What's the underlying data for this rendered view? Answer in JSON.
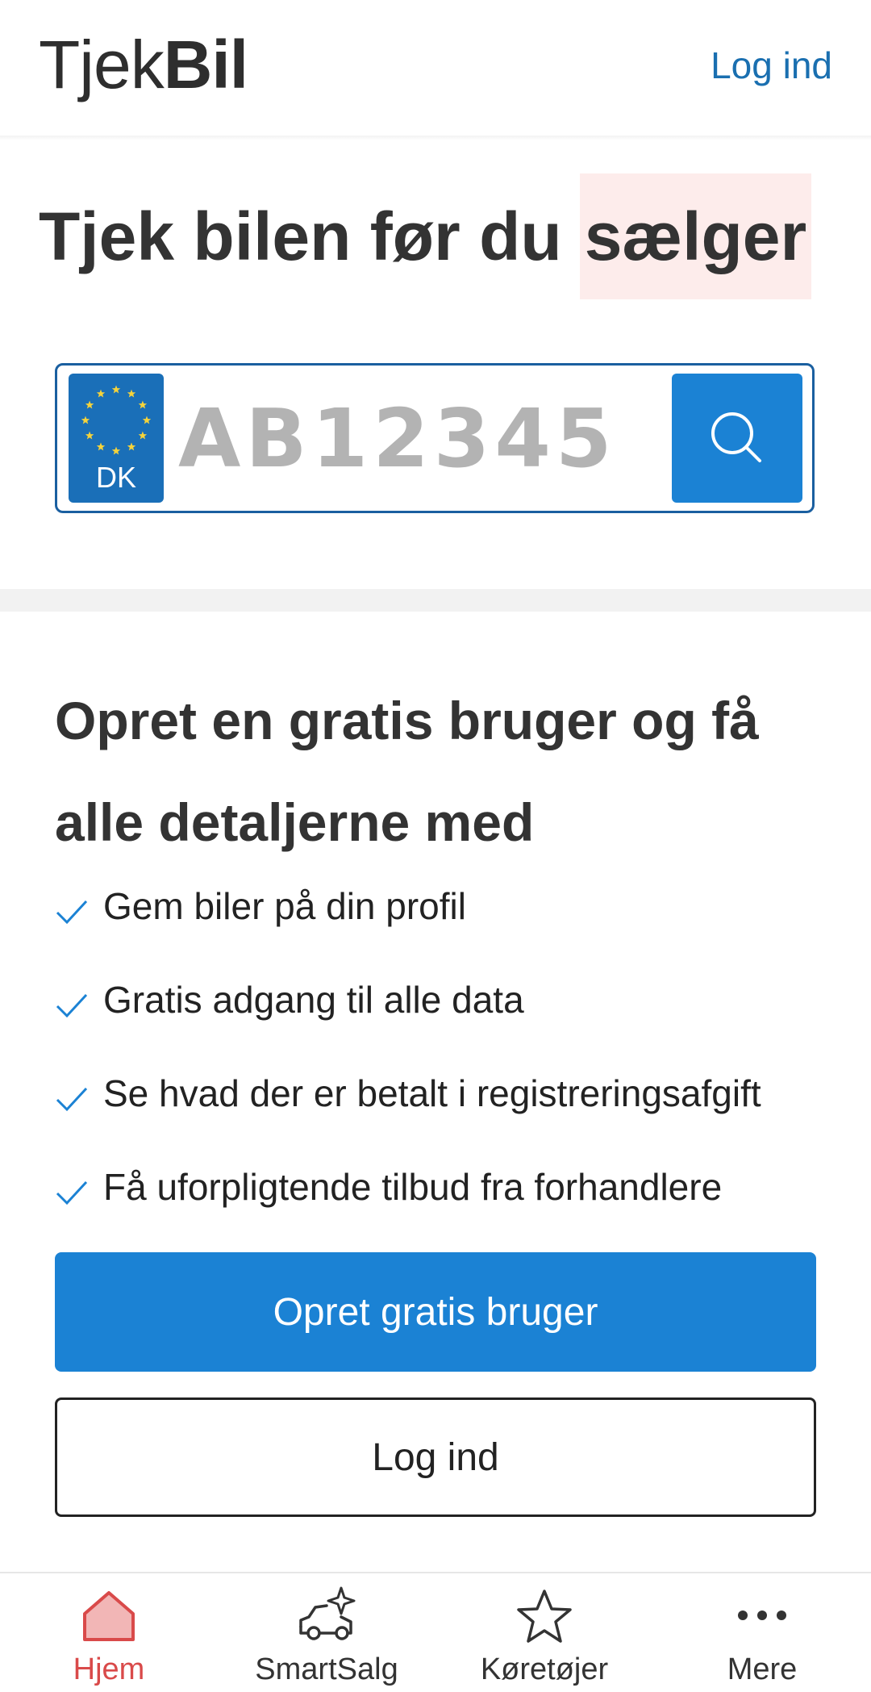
{
  "header": {
    "logo_light": "Tjek",
    "logo_bold": "Bil",
    "login_label": "Log ind"
  },
  "hero": {
    "title_main": "Tjek bilen før du",
    "title_highlight": "sælger"
  },
  "plate_search": {
    "country_code": "DK",
    "placeholder": "AB12345",
    "value": ""
  },
  "signup": {
    "title": "Opret en gratis bruger og få alle detaljerne med",
    "benefits": [
      "Gem biler på din profil",
      "Gratis adgang til alle data",
      "Se hvad der er betalt i registreringsafgift",
      "Få uforpligtende tilbud fra forhandlere"
    ],
    "primary_button": "Opret gratis bruger",
    "secondary_button": "Log ind"
  },
  "bottom_nav": {
    "items": [
      {
        "label": "Hjem",
        "icon": "home-icon",
        "active": true
      },
      {
        "label": "SmartSalg",
        "icon": "car-sparkle-icon",
        "active": false
      },
      {
        "label": "Køretøjer",
        "icon": "star-icon",
        "active": false
      },
      {
        "label": "Mere",
        "icon": "more-dots-icon",
        "active": false
      }
    ]
  },
  "colors": {
    "accent": "#1b82d4",
    "link": "#1a6fb0",
    "highlight_bg": "#fdeceb",
    "active_nav": "#d94a4a",
    "eu_blue": "#1a6fb8",
    "eu_star": "#f5d33b"
  }
}
